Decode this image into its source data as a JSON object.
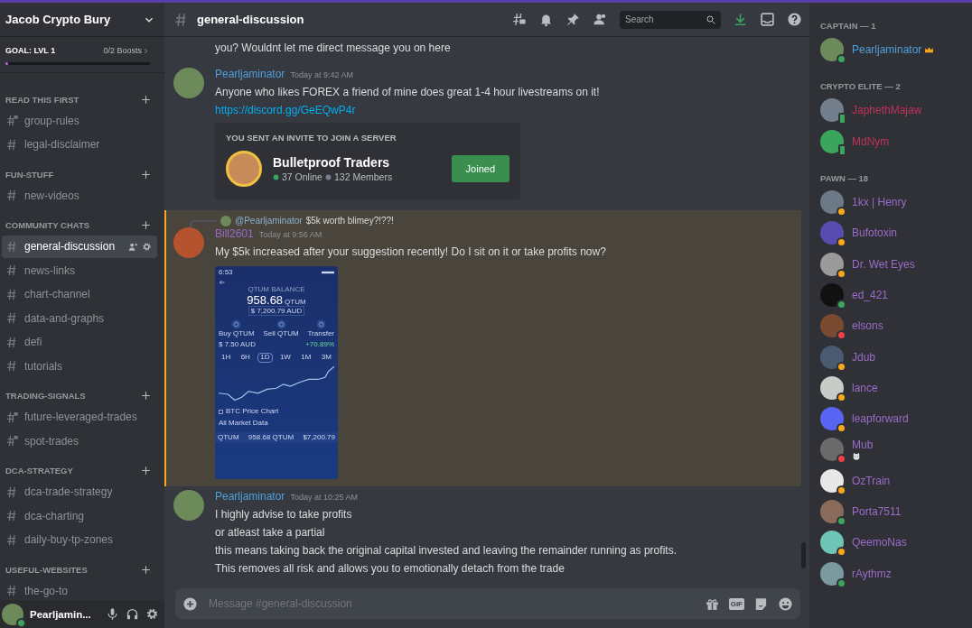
{
  "server": {
    "name": "Jacob Crypto Bury",
    "goal": "GOAL: LVL 1",
    "boosts": "0/2 Boosts",
    "boost_bar": {
      "level": 0.02
    }
  },
  "categories": [
    {
      "name": "READ THIS FIRST",
      "channels": [
        {
          "name": "group-rules",
          "locked": true,
          "selected": false
        },
        {
          "name": "legal-disclaimer",
          "locked": false,
          "selected": false
        }
      ]
    },
    {
      "name": "FUN-STUFF",
      "channels": [
        {
          "name": "new-videos",
          "locked": false,
          "selected": false
        }
      ]
    },
    {
      "name": "COMMUNITY CHATS",
      "channels": [
        {
          "name": "general-discussion",
          "locked": false,
          "selected": true
        },
        {
          "name": "news-links",
          "locked": false,
          "selected": false
        },
        {
          "name": "chart-channel",
          "locked": false,
          "selected": false
        },
        {
          "name": "data-and-graphs",
          "locked": false,
          "selected": false
        },
        {
          "name": "defi",
          "locked": false,
          "selected": false
        },
        {
          "name": "tutorials",
          "locked": false,
          "selected": false
        }
      ]
    },
    {
      "name": "TRADING-SIGNALS",
      "channels": [
        {
          "name": "future-leveraged-trades",
          "locked": true,
          "selected": false
        },
        {
          "name": "spot-trades",
          "locked": true,
          "selected": false
        }
      ]
    },
    {
      "name": "DCA-STRATEGY",
      "channels": [
        {
          "name": "dca-trade-strategy",
          "locked": false,
          "selected": false
        },
        {
          "name": "dca-charting",
          "locked": false,
          "selected": false
        },
        {
          "name": "daily-buy-tp-zones",
          "locked": false,
          "selected": false
        }
      ]
    },
    {
      "name": "USEFUL-WEBSITES",
      "channels": [
        {
          "name": "the-go-to",
          "locked": false,
          "selected": false
        }
      ]
    }
  ],
  "user_panel": {
    "name": "Pearljamin...",
    "color": "#3ba55d"
  },
  "header": {
    "channel": "general-discussion",
    "search": {
      "placeholder": "Search"
    }
  },
  "messages": [
    {
      "kind": "continuation",
      "lines": [
        "you? Wouldnt let me direct message you on here"
      ]
    },
    {
      "kind": "message",
      "author": "Pearljaminator",
      "color": "#4f9fdc",
      "time": "Today at 9:42 AM",
      "lines": [
        "Anyone who likes FOREX a friend of mine does great 1-4 hour livestreams on it!"
      ],
      "link": "https://discord.gg/GeEQwP4r",
      "invite": {
        "heading": "YOU SENT AN INVITE TO JOIN A SERVER",
        "server": "Bulletproof Traders",
        "online": "37 Online",
        "members": "132 Members",
        "button": "Joined"
      }
    },
    {
      "kind": "message",
      "mentioned": true,
      "reply": {
        "author": "@Pearljaminator",
        "text": "$5k worth blimey?!??!"
      },
      "author": "Bill2601",
      "color": "#9b6bc9",
      "time": "Today at 9:56 AM",
      "lines": [
        "My $5k increased after your suggestion recently! Do I sit on it or take profits now?"
      ],
      "attachment": {
        "clock": "6:53",
        "title": "QTUM BALANCE",
        "amount": "958.68",
        "unit": "QTUM",
        "fiat": "$ 7,200.79 AUD",
        "actions": [
          "Buy QTUM",
          "Sell QTUM",
          "Transfer"
        ],
        "price": "$ 7.50 AUD",
        "change": "+70.89%",
        "ranges": [
          {
            "label": "1H",
            "selected": false
          },
          {
            "label": "6H",
            "selected": false
          },
          {
            "label": "1D",
            "selected": true
          },
          {
            "label": "1W",
            "selected": false
          },
          {
            "label": "1M",
            "selected": false
          },
          {
            "label": "3M",
            "selected": false
          }
        ],
        "toggle": "BTC Price Chart",
        "more": "All Market Data",
        "footer_asset": "QTUM",
        "footer_amount": "958.68 QTUM",
        "footer_value": "$7,200.79"
      }
    },
    {
      "kind": "message",
      "author": "Pearljaminator",
      "color": "#4f9fdc",
      "time": "Today at 10:25 AM",
      "lines": [
        "I highly advise to take profits",
        "or atleast take a partial",
        "this means taking back the original capital invested and leaving the remainder running as profits.",
        "This removes all risk and allows you to emotionally detach from the trade"
      ]
    }
  ],
  "composer": {
    "placeholder": "Message #general-discussion",
    "gif": "GIF"
  },
  "roles": [
    {
      "name": "CAPTAIN — 1",
      "color": "#4f9fdc",
      "members": [
        {
          "name": "Pearljaminator",
          "color": "#3ba55d",
          "mobile": false,
          "owner": true
        }
      ]
    },
    {
      "name": "CRYPTO ELITE — 2",
      "color": "#c0325a",
      "members": [
        {
          "name": "JaphethMajaw",
          "color": "#3ba55d",
          "mobile": true,
          "owner": false
        },
        {
          "name": "MdNym",
          "color": "#3ba55d",
          "mobile": true,
          "owner": false
        }
      ]
    },
    {
      "name": "PAWN — 18",
      "color": "#9b6bc9",
      "members": [
        {
          "name": "1kx | Henry",
          "color": "#faa81a",
          "mobile": false,
          "owner": false
        },
        {
          "name": "Bufotoxin",
          "color": "#faa81a",
          "mobile": false,
          "owner": false
        },
        {
          "name": "Dr. Wet Eyes",
          "color": "#faa81a",
          "mobile": false,
          "owner": false
        },
        {
          "name": "ed_421",
          "color": "#3ba55d",
          "mobile": false,
          "owner": false
        },
        {
          "name": "elsons",
          "color": "#ed4245",
          "mobile": false,
          "owner": false
        },
        {
          "name": "Jdub",
          "color": "#faa81a",
          "mobile": false,
          "owner": false
        },
        {
          "name": "lance",
          "color": "#faa81a",
          "mobile": false,
          "owner": false
        },
        {
          "name": "leapforward",
          "color": "#faa81a",
          "mobile": false,
          "owner": false
        },
        {
          "name": "Mub",
          "color": "#ed4245",
          "mobile": false,
          "owner": false,
          "custom_status": true
        },
        {
          "name": "OzTrain",
          "color": "#faa81a",
          "mobile": false,
          "owner": false
        },
        {
          "name": "Porta7511",
          "color": "#3ba55d",
          "mobile": false,
          "owner": false
        },
        {
          "name": "QeemoNas",
          "color": "#faa81a",
          "mobile": false,
          "owner": false
        },
        {
          "name": "rAythmz",
          "color": "#3ba55d",
          "mobile": false,
          "owner": false
        }
      ]
    }
  ]
}
